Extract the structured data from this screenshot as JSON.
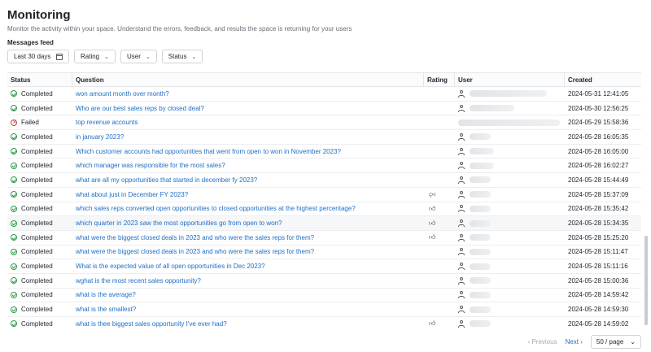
{
  "page": {
    "title": "Monitoring",
    "description": "Monitor the activity within your space. Understand the errors, feedback, and results the space is returning for your users",
    "feed_label": "Messages feed"
  },
  "filters": {
    "date": "Last 30 days",
    "rating": "Rating",
    "user": "User",
    "status": "Status"
  },
  "table": {
    "headers": [
      "Status",
      "Question",
      "Rating",
      "User",
      "Created"
    ],
    "rows": [
      {
        "status": "Completed",
        "question": "won amount month over month?",
        "rating": "",
        "created": "2024-05-31 12:41:05"
      },
      {
        "status": "Completed",
        "question": "Who are our best sales reps by closed deal?",
        "rating": "",
        "created": "2024-05-30 12:56:25"
      },
      {
        "status": "Failed",
        "question": "top revenue accounts",
        "rating": "",
        "created": "2024-05-29 15:58:36"
      },
      {
        "status": "Completed",
        "question": "in january 2023?",
        "rating": "",
        "created": "2024-05-28 16:05:35"
      },
      {
        "status": "Completed",
        "question": "Which customer accounts had opportunities that went from open to won in November 2023?",
        "rating": "",
        "created": "2024-05-28 16:05:00"
      },
      {
        "status": "Completed",
        "question": "which manager was responsible for the most sales?",
        "rating": "",
        "created": "2024-05-28 16:02:27"
      },
      {
        "status": "Completed",
        "question": "what are all my opportunities that started in december fy 2023?",
        "rating": "",
        "created": "2024-05-28 15:44:49"
      },
      {
        "status": "Completed",
        "question": "what about just in December FY 2023?",
        "rating": "down",
        "created": "2024-05-28 15:37:09"
      },
      {
        "status": "Completed",
        "question": "which sales reps converted open opportunities to closed opportunities at the highest percentage?",
        "rating": "up",
        "created": "2024-05-28 15:35:42"
      },
      {
        "status": "Completed",
        "question": "which quarter in 2023 saw the most opportunities go from open to won?",
        "rating": "up",
        "created": "2024-05-28 15:34:35"
      },
      {
        "status": "Completed",
        "question": "what were the biggest closed deals in 2023 and who were the sales reps for them?",
        "rating": "up",
        "created": "2024-05-28 15:25:20"
      },
      {
        "status": "Completed",
        "question": "what were the biggest closed deals in 2023 and who were the sales reps for them?",
        "rating": "",
        "created": "2024-05-28 15:11:47"
      },
      {
        "status": "Completed",
        "question": "What is the expected value of all open opportunities in Dec 2023?",
        "rating": "",
        "created": "2024-05-28 15:11:16"
      },
      {
        "status": "Completed",
        "question": "wghat is the most recent sales opportunity?",
        "rating": "",
        "created": "2024-05-28 15:00:36"
      },
      {
        "status": "Completed",
        "question": "what is the average?",
        "rating": "",
        "created": "2024-05-28 14:59:42"
      },
      {
        "status": "Completed",
        "question": "what is the smallest?",
        "rating": "",
        "created": "2024-05-28 14:59:30"
      },
      {
        "status": "Completed",
        "question": "what is thee biggest sales opportunity I've ever had?",
        "rating": "up",
        "created": "2024-05-28 14:59:02"
      }
    ]
  },
  "pagination": {
    "previous": "Previous",
    "next": "Next",
    "page_size": "50 / page"
  },
  "colors": {
    "link": "#1f6fc5",
    "completed": "#2e9b4a",
    "failed": "#d23c3c"
  }
}
